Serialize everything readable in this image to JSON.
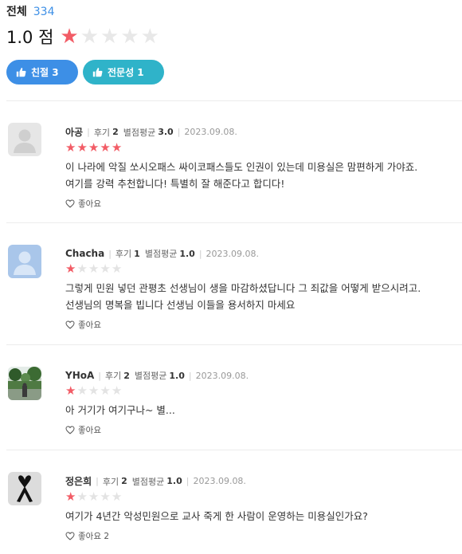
{
  "summary": {
    "total_label": "전체",
    "total_count": "334",
    "score_text": "1.0 점",
    "score_value": 1,
    "score_max": 5
  },
  "chips": [
    {
      "label": "친절 3",
      "color": "#3d8fe6"
    },
    {
      "label": "전문성 1",
      "color": "#2fb3c9"
    }
  ],
  "labels": {
    "reviews_key": "후기",
    "avg_key": "별점평균"
  },
  "reviews": [
    {
      "nickname": "아공",
      "reviews_count": "2",
      "avg": "3.0",
      "date": "2023.09.08.",
      "rating": 5,
      "avatar": "default-gray-avatar",
      "text_lines": [
        "이 나라에 악질 쏘시오패스 싸이코패스들도 인권이 있는데 미용실은 맘편하게 가야죠.",
        "여기를 강력 추천합니다!  특별히 잘 해준다고 합디다!"
      ],
      "like_label": "좋아요"
    },
    {
      "nickname": "Chacha",
      "reviews_count": "1",
      "avg": "1.0",
      "date": "2023.09.08.",
      "rating": 1,
      "avatar": "default-blue-avatar",
      "text_lines": [
        "그렇게 민원 넣던 관평초 선생님이 생을 마감하셨답니다 그 죄값을 어떻게 받으시려고.",
        "선생님의 명복을 빕니다 선생님 이들을 용서하지 마세요"
      ],
      "like_label": "좋아요"
    },
    {
      "nickname": "YHoA",
      "reviews_count": "2",
      "avg": "1.0",
      "date": "2023.09.08.",
      "rating": 1,
      "avatar": "landscape-photo-avatar",
      "text_lines": [
        "아 거기가 여기구나~ 별..."
      ],
      "like_label": "좋아요"
    },
    {
      "nickname": "정은희",
      "reviews_count": "2",
      "avg": "1.0",
      "date": "2023.09.08.",
      "rating": 1,
      "avatar": "mourning-ribbon-avatar",
      "text_lines": [
        "여기가 4년간 악성민원으로 교사 죽게 한 사람이 운영하는 미용실인가요?"
      ],
      "like_label": "좋아요 2"
    }
  ]
}
